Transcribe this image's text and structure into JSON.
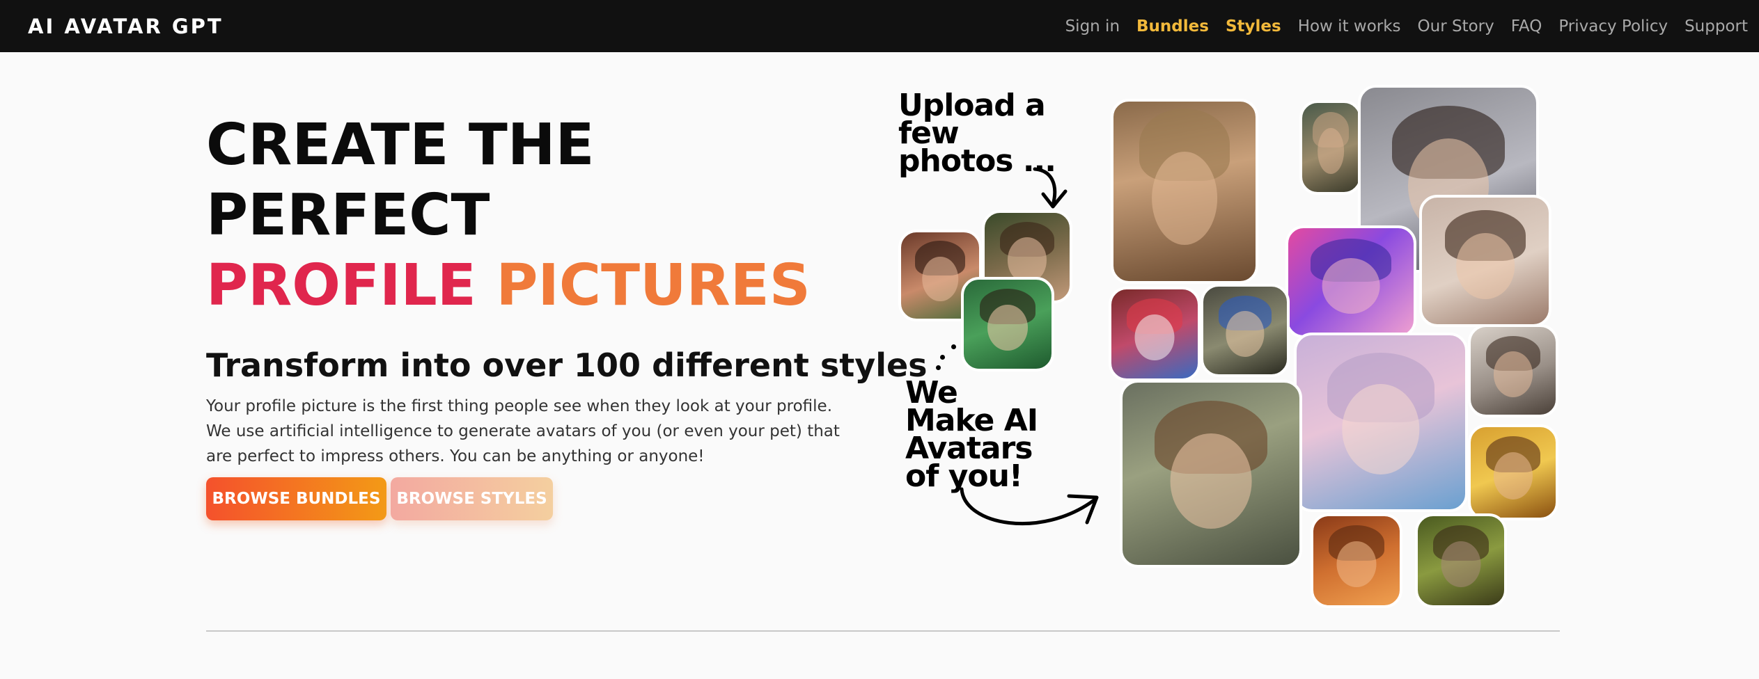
{
  "brand": "AI AVATAR GPT",
  "nav": {
    "sign_in": "Sign in",
    "bundles": "Bundles",
    "styles": "Styles",
    "how_it_works": "How it works",
    "our_story": "Our Story",
    "faq": "FAQ",
    "privacy_policy": "Privacy Policy",
    "support": "Support"
  },
  "hero": {
    "line1": "CREATE THE",
    "line2": "PERFECT",
    "line3_word1": "PROFILE",
    "line3_word2": "PICTURES",
    "subtitle": "Transform into over 100 different styles",
    "description": "Your profile picture is the first thing people see when they look at your profile. We use artificial intelligence to generate avatars of you (or even your pet) that are perfect to impress others. You can be anything or anyone!",
    "btn_bundles": "BROWSE BUNDLES",
    "btn_styles": "BROWSE STYLES"
  },
  "collage": {
    "upload_text_1": "Upload a",
    "upload_text_2": "few",
    "upload_text_3": "photos ...",
    "make_text_1": "We",
    "make_text_2": "Make AI",
    "make_text_3": "Avatars",
    "make_text_4": "of you!"
  },
  "colors": {
    "nav_bg": "#111111",
    "nav_highlight": "#f2b93b",
    "accent_red": "#e0264d",
    "accent_orange": "#f07a3a",
    "btn_primary_start": "#f4512c",
    "btn_primary_end": "#f39a16"
  }
}
